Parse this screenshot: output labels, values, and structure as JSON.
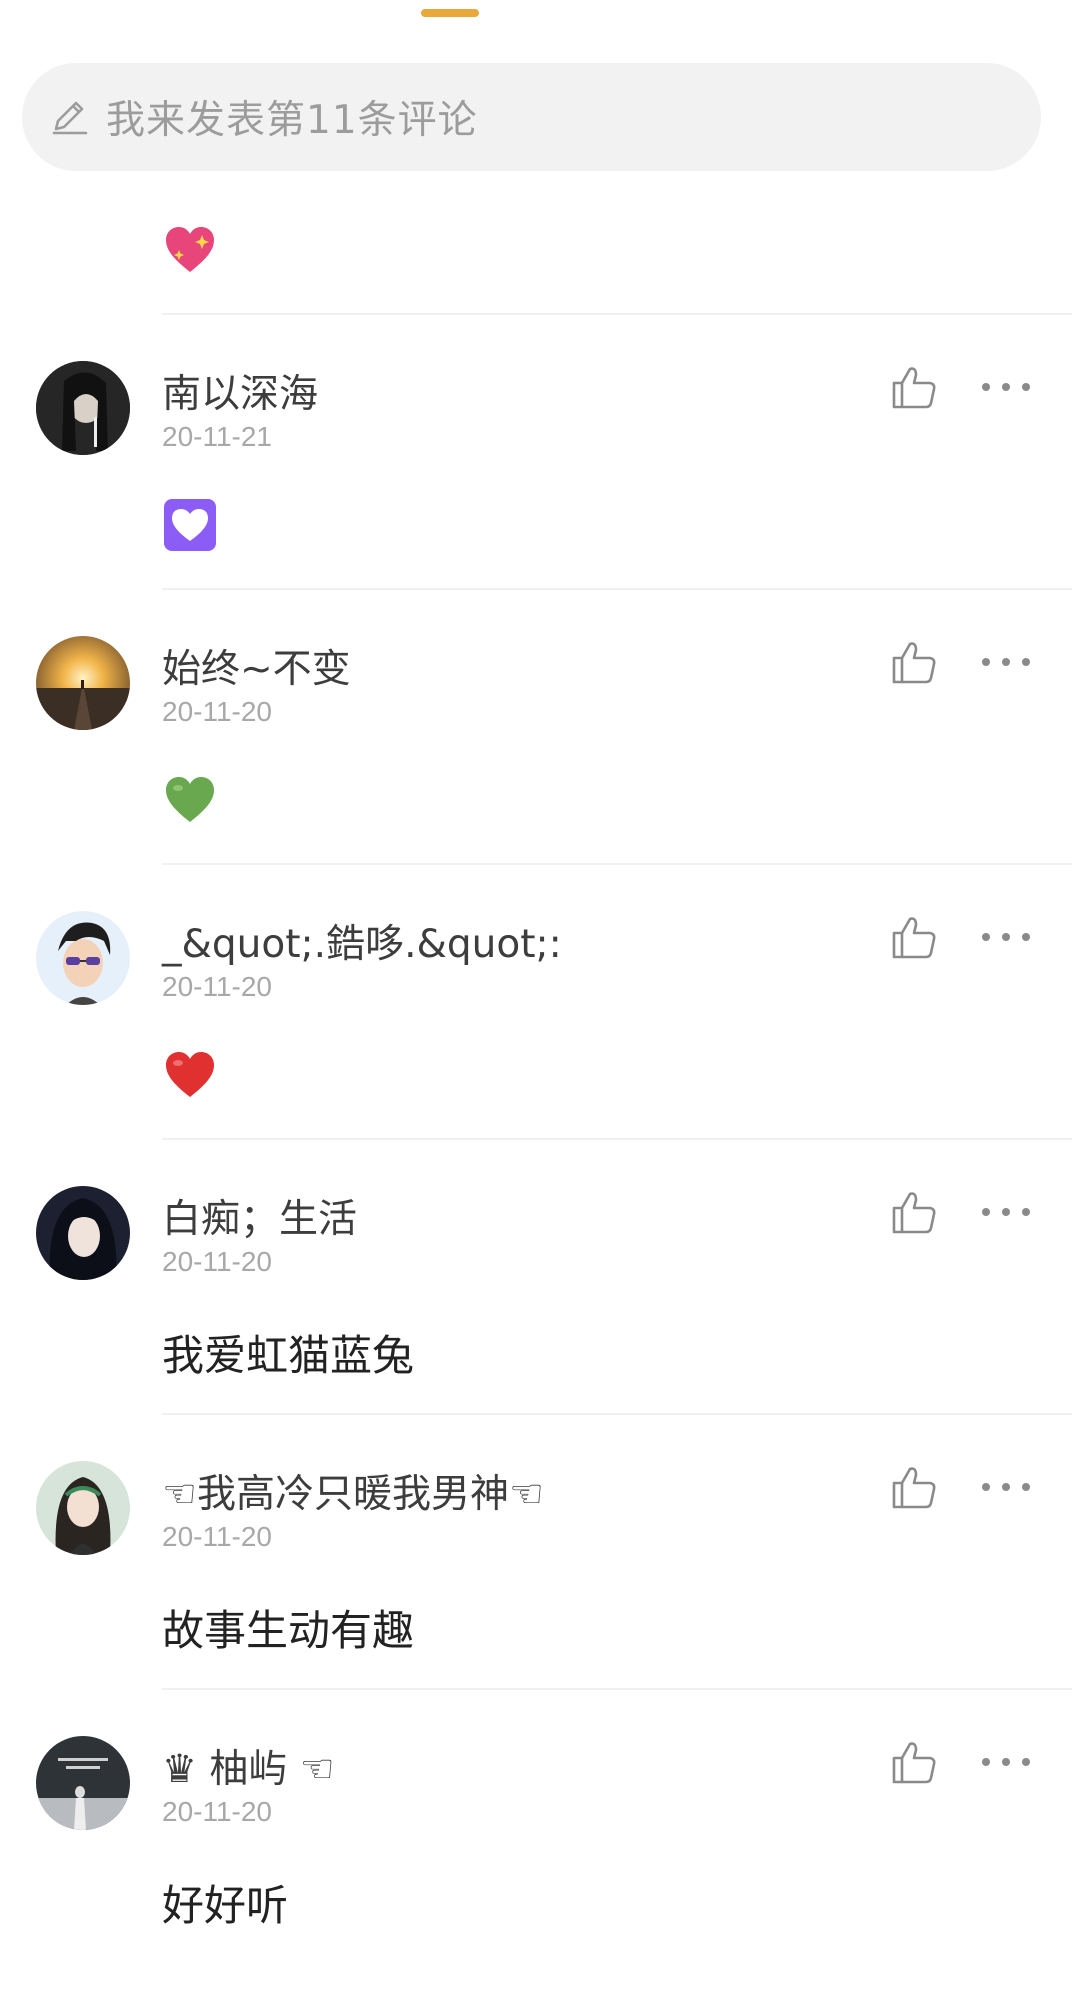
{
  "comment_input": {
    "placeholder": "我来发表第11条评论",
    "icon": "pencil-icon"
  },
  "top_comment_content": {
    "emoji": "sparkling-heart",
    "color": "#e8457a"
  },
  "comments": [
    {
      "username": "南以深海",
      "date": "20-11-21",
      "content_type": "emoji",
      "emoji": "white-heart-purple-square",
      "emoji_color": "#8b5cf6"
    },
    {
      "username": "始终~不变",
      "date": "20-11-20",
      "content_type": "emoji",
      "emoji": "green-heart",
      "emoji_color": "#6aa84f"
    },
    {
      "username": "_&quot;.鋯哆.&quot;:",
      "date": "20-11-20",
      "content_type": "emoji",
      "emoji": "red-heart",
      "emoji_color": "#e0302f"
    },
    {
      "username": "白痴；生活",
      "date": "20-11-20",
      "content_type": "text",
      "text": "我爱虹猫蓝兔"
    },
    {
      "username": "☜我高冷只暖我男神☜",
      "date": "20-11-20",
      "content_type": "text",
      "text": "故事生动有趣"
    },
    {
      "username": "♛ 柚屿 ☜",
      "date": "20-11-20",
      "content_type": "text",
      "text": "好好听"
    }
  ],
  "icons": {
    "like": "thumbs-up-icon",
    "more": "more-dots-icon"
  },
  "colors": {
    "accent": "#e8a93a",
    "input_bg": "#f2f2f2",
    "date": "#a8a8a8",
    "icon": "#8a8a8a"
  }
}
